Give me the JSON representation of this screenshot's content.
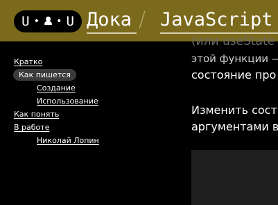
{
  "header": {
    "logo": {
      "left": "U",
      "right": "U"
    },
    "breadcrumb": {
      "home": "Дока",
      "separator": "/",
      "section": "JavaScript"
    }
  },
  "nav": {
    "items": [
      {
        "label": "Кратко",
        "active": false,
        "indent": false
      },
      {
        "label": "Как пишется",
        "active": true,
        "indent": false
      },
      {
        "label": "Создание",
        "active": false,
        "indent": true
      },
      {
        "label": "Использование",
        "active": false,
        "indent": true
      },
      {
        "label": "Как понять",
        "active": false,
        "indent": false
      },
      {
        "label": "В работе",
        "active": false,
        "indent": false
      },
      {
        "label": "Николай Лопин",
        "active": false,
        "indent": true
      }
    ]
  },
  "content": {
    "cut_top_line": "(или useState",
    "para1_line1": "этой функции —",
    "para1_line2": "состояние про",
    "para2_line1": "Изменить сост",
    "para2_line2": "аргументами в"
  },
  "colors": {
    "header_bg": "#7b6a1c",
    "page_bg": "#000000",
    "active_nav_bg": "#3b3b3b",
    "code_bg": "#1e1e1e"
  }
}
